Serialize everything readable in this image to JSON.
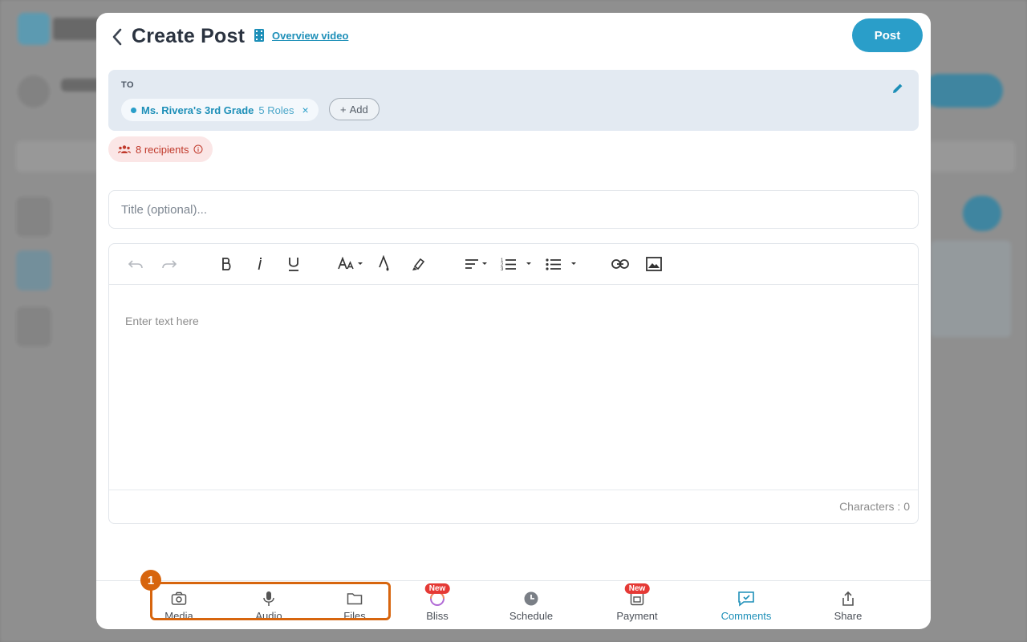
{
  "header": {
    "title": "Create Post",
    "overview_link": "Overview video",
    "post_button": "Post"
  },
  "to": {
    "label": "TO",
    "chip_name": "Ms. Rivera's 3rd Grade",
    "chip_roles": "5 Roles",
    "chip_remove": "×",
    "add_label": "Add",
    "add_plus": "+"
  },
  "recipients": {
    "label": "8 recipients"
  },
  "title_input": {
    "placeholder": "Title (optional)..."
  },
  "editor": {
    "placeholder": "Enter text here",
    "char_count": "Characters : 0",
    "toolbar_icons": [
      "undo-icon",
      "redo-icon",
      "bold-icon",
      "italic-icon",
      "underline-icon",
      "font-size-icon",
      "text-color-icon",
      "highlight-icon",
      "align-icon",
      "numbered-list-icon",
      "bullet-list-icon",
      "link-icon",
      "image-icon"
    ]
  },
  "bottom_bar": {
    "items": [
      {
        "label": "Media",
        "icon": "camera-icon"
      },
      {
        "label": "Audio",
        "icon": "microphone-icon"
      },
      {
        "label": "Files",
        "icon": "folder-icon"
      },
      {
        "label": "Bliss",
        "icon": "bliss-icon",
        "badge": "New"
      },
      {
        "label": "Schedule",
        "icon": "clock-icon"
      },
      {
        "label": "Payment",
        "icon": "payment-icon",
        "badge": "New"
      },
      {
        "label": "Comments",
        "icon": "comments-icon",
        "active": true
      },
      {
        "label": "Share",
        "icon": "share-icon"
      }
    ]
  },
  "step_marker": "1",
  "colors": {
    "accent": "#2a9ec9",
    "highlight": "#d7650e",
    "new_badge": "#e53935",
    "recipients_text": "#c0392b"
  }
}
